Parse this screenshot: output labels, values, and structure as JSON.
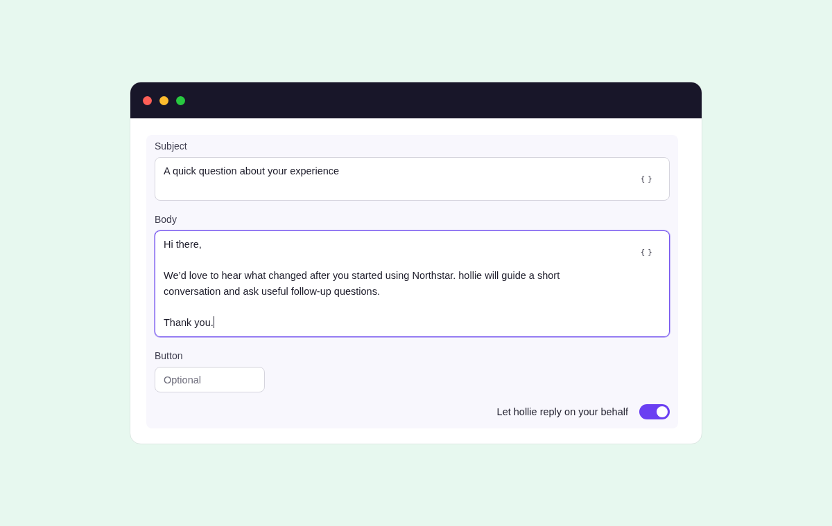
{
  "window": {
    "controls": [
      {
        "color": "#ff5f57"
      },
      {
        "color": "#febc2e"
      },
      {
        "color": "#28c840"
      }
    ]
  },
  "form": {
    "fields": [
      {
        "kind": "line",
        "label": "Subject",
        "value": "A quick question about your experience",
        "variable_button": "{ }",
        "focused": false
      },
      {
        "kind": "area",
        "label": "Body",
        "value": "Hi there,\n\nWe’d love to hear what changed after you started using Northstar. hollie will guide a short conversation and ask useful follow-up questions.\n\nThank you.",
        "variable_button": "{ }",
        "focused": true
      },
      {
        "kind": "input",
        "label": "Button",
        "placeholder": "Optional"
      }
    ],
    "reply_toggle": {
      "label": "Let hollie reply on your behalf",
      "on": true
    }
  }
}
